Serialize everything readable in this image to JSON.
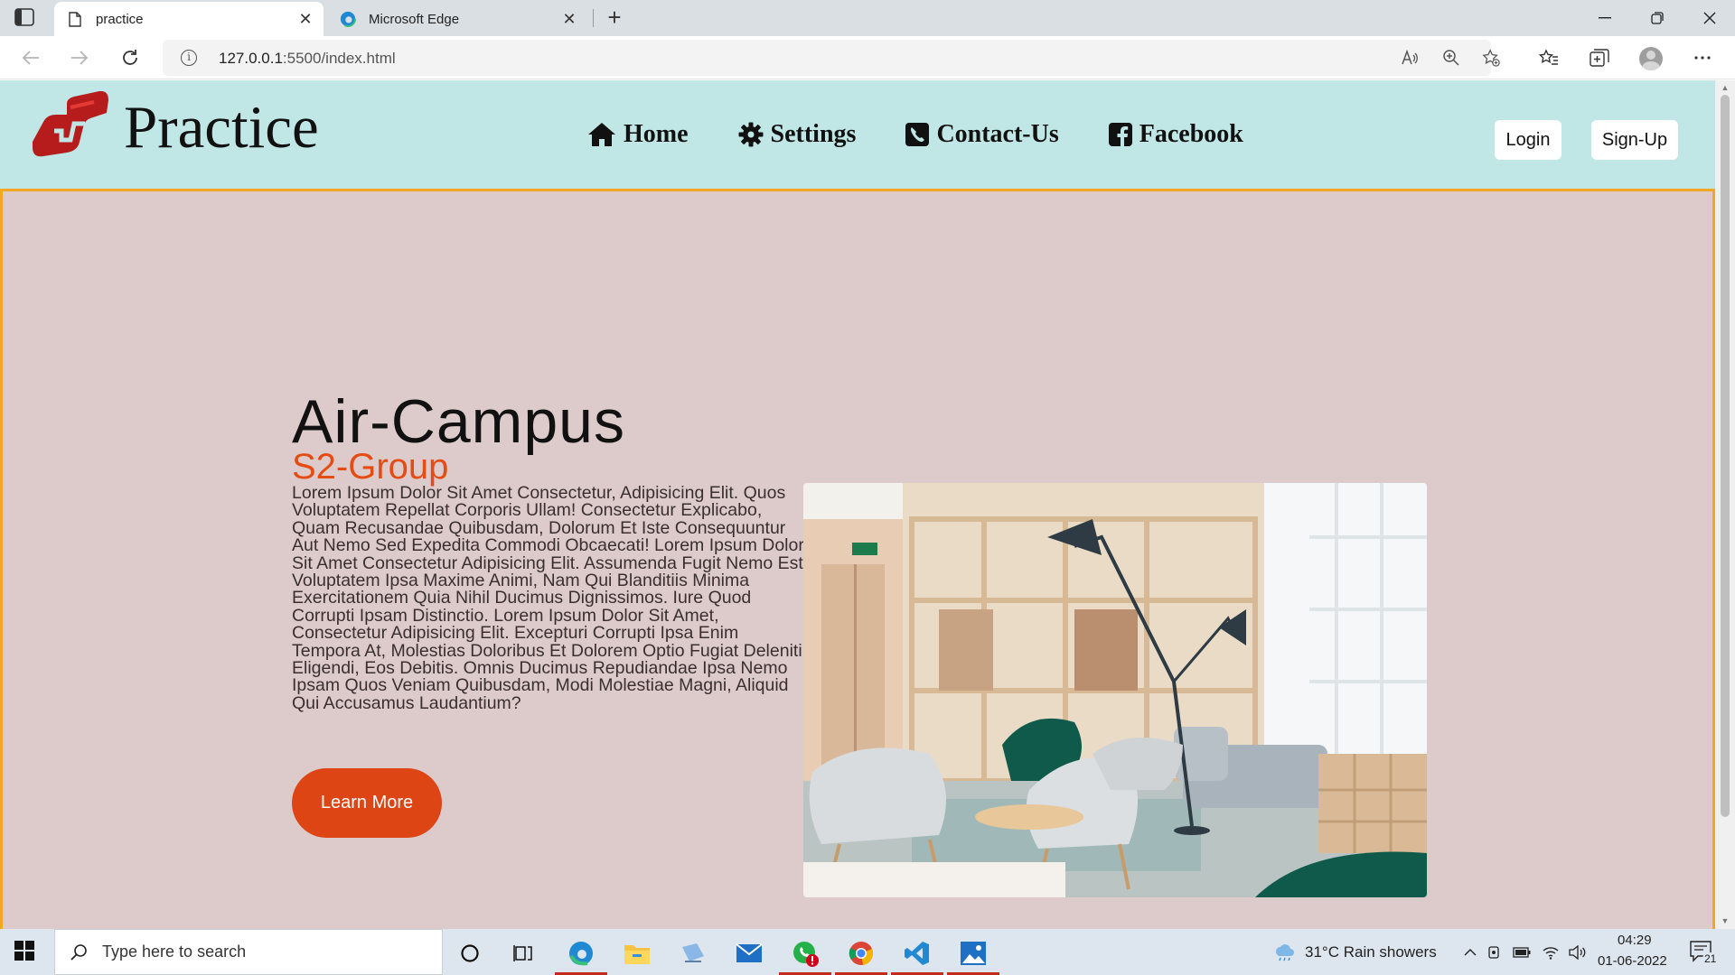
{
  "browser": {
    "tabs": [
      {
        "title": "practice",
        "active": true
      },
      {
        "title": "Microsoft Edge",
        "active": false
      }
    ],
    "url_host": "127.0.0.1",
    "url_path": ":5500/index.html"
  },
  "site": {
    "logo_text": "Practice",
    "nav": [
      {
        "label": "Home",
        "icon": "home-icon"
      },
      {
        "label": "Settings",
        "icon": "gear-icon"
      },
      {
        "label": "Contact-Us",
        "icon": "phone-icon"
      },
      {
        "label": "Facebook",
        "icon": "facebook-icon"
      }
    ],
    "login_label": "Login",
    "signup_label": "Sign-Up"
  },
  "hero": {
    "title": "Air-Campus",
    "subtitle": "S2-Group",
    "body": "Lorem Ipsum Dolor Sit Amet Consectetur, Adipisicing Elit. Quos Voluptatem Repellat Corporis Ullam! Consectetur Explicabo, Quam Recusandae Quibusdam, Dolorum Et Iste Consequuntur Aut Nemo Sed Expedita Commodi Obcaecati! Lorem Ipsum Dolor Sit Amet Consectetur Adipisicing Elit. Assumenda Fugit Nemo Est Voluptatem Ipsa Maxime Animi, Nam Qui Blanditiis Minima Exercitationem Quia Nihil Ducimus Dignissimos. Iure Quod Corrupti Ipsam Distinctio. Lorem Ipsum Dolor Sit Amet, Consectetur Adipisicing Elit. Excepturi Corrupti Ipsa Enim Tempora At, Molestias Doloribus Et Dolorem Optio Fugiat Deleniti Eligendi, Eos Debitis. Omnis Ducimus Repudiandae Ipsa Nemo Ipsam Quos Veniam Quibusdam, Modi Molestiae Magni, Aliquid Qui Accusamus Laudantium?",
    "button_label": "Learn More"
  },
  "taskbar": {
    "search_placeholder": "Type here to search",
    "weather": "31°C  Rain showers",
    "time": "04:29",
    "date": "01-06-2022",
    "notifications": "21"
  },
  "colors": {
    "header_bg": "#c1e6e6",
    "page_bg": "#ddcbcc",
    "hero_border": "#f5a623",
    "accent": "#e54b12",
    "button": "#dd4515",
    "logo": "#b71c1c"
  }
}
